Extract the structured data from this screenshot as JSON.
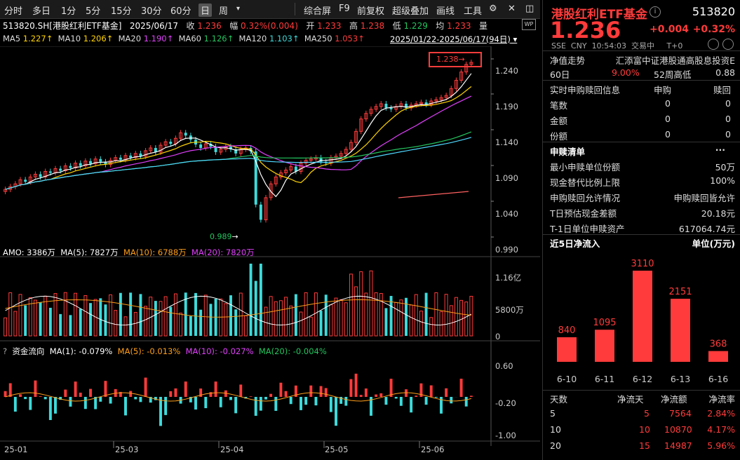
{
  "toolbar": {
    "periods": [
      "分时",
      "多日",
      "1分",
      "5分",
      "15分",
      "30分",
      "60分",
      "日",
      "周"
    ],
    "selected": "日",
    "dropdown": "▾",
    "right": [
      "综合屏",
      "F9",
      "前复权",
      "超级叠加",
      "画线",
      "工具"
    ]
  },
  "quote_line": {
    "code": "513820.SH[港股红利ETF基金]",
    "date": "2025/06/17",
    "close_label": "收",
    "close": "1.236",
    "amp_label": "幅",
    "amp": "0.32%(0.004)",
    "open_label": "开",
    "open": "1.233",
    "high_label": "高",
    "high": "1.238",
    "low_label": "低",
    "low": "1.229",
    "vol_label": "均",
    "vol": "1.233",
    "unit": "量"
  },
  "ma_line": {
    "ma5_label": "MA5",
    "ma5": "1.227↑",
    "ma10_label": "MA10",
    "ma10": "1.206↑",
    "ma20_label": "MA20",
    "ma20": "1.190↑",
    "ma60_label": "MA60",
    "ma60": "1.126↑",
    "ma120_label": "MA120",
    "ma120": "1.103↑",
    "ma250_label": "MA250",
    "ma250": "1.053↑",
    "range": "2025/01/22-2025/06/17(94日)"
  },
  "colors": {
    "up": "#ff3b3b",
    "down": "#3ddbdb",
    "ma5": "#ffffff",
    "ma10": "#ffd400",
    "ma20": "#e040fb",
    "ma60": "#23c55e",
    "ma120": "#4fd8ff",
    "ma250": "#ff6060"
  },
  "price_axis": [
    "1.240",
    "1.190",
    "1.140",
    "1.090",
    "1.040",
    "0.990"
  ],
  "annotations": {
    "high_mark": "1.238",
    "high_arrow": "→",
    "low_mark": "0.989",
    "low_arrow": "→"
  },
  "amo_line": {
    "amo": "AMO: 3386万",
    "ma5": "MA(5): 7827万",
    "ma10": "MA(10): 6788万",
    "ma20": "MA(20): 7820万"
  },
  "amo_axis": [
    "1.16亿",
    "5800万",
    "0"
  ],
  "flow_line": {
    "q": "?",
    "title": "资金流向",
    "ma1": "MA(1): -0.079%",
    "ma5": "MA(5): -0.013%",
    "ma10": "MA(10): -0.027%",
    "ma20": "MA(20): -0.004%"
  },
  "flow_axis": [
    "0.60",
    "-0.20",
    "-1.00"
  ],
  "date_axis": [
    "25-01",
    "25-03",
    "25-04",
    "25-05",
    "25-06"
  ],
  "right_panel": {
    "name": "港股红利ETF基金",
    "info_icon": "i",
    "code": "513820",
    "price": "1.236",
    "change": "+0.004",
    "pct": "+0.32%",
    "sub": [
      "SSE",
      "CNY",
      "10:54:03",
      "交易中",
      "T+0"
    ],
    "nav_label": "净值走势",
    "nav_value": "汇添富中证港股通高股息投资E",
    "d60_label": "60日",
    "d60": "9.00%",
    "w52_label": "52周高低",
    "w52": "0.88",
    "sg_title": "实时申购赎回信息",
    "sg_col1": "申购",
    "sg_col2": "赎回",
    "sg_rows": [
      {
        "k": "笔数",
        "a": "0",
        "b": "0"
      },
      {
        "k": "金额",
        "a": "0",
        "b": "0"
      },
      {
        "k": "份额",
        "a": "0",
        "b": "0"
      }
    ],
    "list_title": "申赎清单",
    "list_more": "···",
    "list_rows": [
      {
        "k": "最小申赎单位份额",
        "v": "50万"
      },
      {
        "k": "现金替代比例上限",
        "v": "100%"
      },
      {
        "k": "申购赎回允许情况",
        "v": "申购赎回皆允许"
      },
      {
        "k": "T日预估现金差额",
        "v": "20.18元"
      },
      {
        "k": "T-1日单位申赎资产",
        "v": "617064.74元"
      }
    ],
    "flow_title": "近5日净流入",
    "flow_unit": "单位(万元)",
    "flow_bars": [
      {
        "d": "6-10",
        "v": 840
      },
      {
        "d": "6-11",
        "v": 1095
      },
      {
        "d": "6-12",
        "v": 3110
      },
      {
        "d": "6-13",
        "v": 2151
      },
      {
        "d": "6-16",
        "v": 368
      }
    ],
    "tbl_head": [
      "天数",
      "净流天",
      "净流额",
      "净流率"
    ],
    "tbl_rows": [
      [
        "5",
        "5",
        "7564",
        "2.84%"
      ],
      [
        "10",
        "10",
        "10870",
        "4.17%"
      ],
      [
        "20",
        "15",
        "14987",
        "5.96%"
      ]
    ]
  },
  "chart_data": {
    "type": "candlestick",
    "ylim": [
      0.98,
      1.245
    ],
    "closes": [
      1.052,
      1.056,
      1.06,
      1.066,
      1.063,
      1.07,
      1.074,
      1.07,
      1.078,
      1.076,
      1.082,
      1.079,
      1.086,
      1.083,
      1.09,
      1.086,
      1.093,
      1.089,
      1.096,
      1.092,
      1.088,
      1.094,
      1.098,
      1.095,
      1.101,
      1.098,
      1.104,
      1.1,
      1.108,
      1.112,
      1.106,
      1.116,
      1.121,
      1.118,
      1.126,
      1.134,
      1.13,
      1.124,
      1.117,
      1.112,
      1.118,
      1.114,
      1.106,
      1.11,
      1.114,
      1.11,
      1.104,
      1.11,
      1.112,
      1.107,
      1.03,
      1.008,
      1.04,
      1.06,
      1.07,
      1.076,
      1.08,
      1.085,
      1.078,
      1.09,
      1.094,
      1.096,
      1.098,
      1.092,
      1.09,
      1.098,
      1.1,
      1.104,
      1.11,
      1.12,
      1.136,
      1.154,
      1.162,
      1.168,
      1.172,
      1.176,
      1.17,
      1.168,
      1.172,
      1.176,
      1.17,
      1.174,
      1.176,
      1.178,
      1.175,
      1.18,
      1.182,
      1.185,
      1.188,
      1.198,
      1.21,
      1.222,
      1.233,
      1.236
    ]
  }
}
